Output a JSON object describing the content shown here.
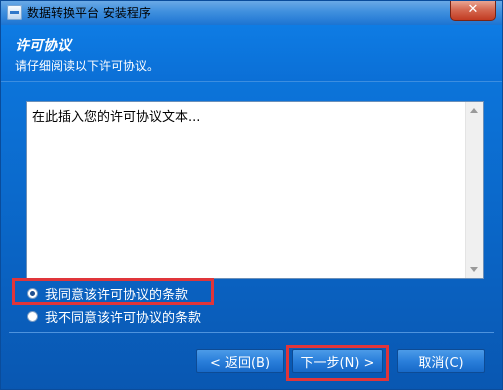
{
  "window": {
    "title": "数据转换平台 安装程序",
    "close_glyph": "✕"
  },
  "header": {
    "title": "许可协议",
    "subtitle": "请仔细阅读以下许可协议。"
  },
  "license": {
    "text": "在此插入您的许可协议文本..."
  },
  "options": {
    "agree_label": "我同意该许可协议的条款",
    "disagree_label": "我不同意该许可协议的条款",
    "selected": "agree"
  },
  "buttons": {
    "back_label": "< 返回(B)",
    "next_label": "下一步(N) >",
    "cancel_label": "取消(C)"
  },
  "icons": {
    "app": "setup-app-icon",
    "close": "close-icon",
    "radio_checked": "radio-checked-icon",
    "radio_unchecked": "radio-unchecked-icon",
    "scroll_up": "chevron-up-icon",
    "scroll_down": "chevron-down-icon"
  },
  "colors": {
    "accent_blue": "#0b6fd6",
    "highlight_red": "#e0353a",
    "close_red": "#c23b22"
  }
}
